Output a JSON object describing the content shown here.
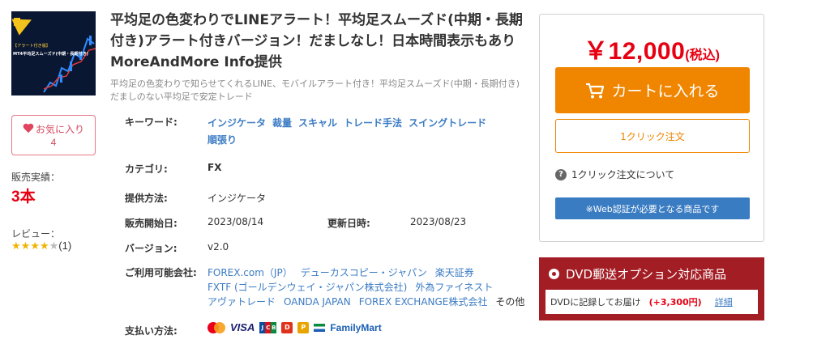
{
  "product": {
    "thumbnail": {
      "tag_line1": "【アラート付き版】",
      "tag_line2": "MT4平均足スムーズド(中期・長期付き)"
    },
    "title": "平均足の色変わりでLINEアラート！平均足スムーズド(中期・長期付き)アラート付きバージョン！だましなし！日本時間表示もあり MoreAndMore Info提供",
    "subtitle": "平均足の色変わりで知らせてくれるLINE、モバイルアラート付き！平均足スムーズド(中期・長期付き)　だましのない平均足で安定トレード"
  },
  "favorite": {
    "label": "お気に入り",
    "count": "4"
  },
  "sales": {
    "label": "販売実績：",
    "value": "3本"
  },
  "review": {
    "label": "レビュー：",
    "stars_filled": 4,
    "stars_total": 5,
    "count": "(1)"
  },
  "details": {
    "keyword_label": "キーワード:",
    "keywords": [
      "インジケータ",
      "裁量",
      "スキャル",
      "トレード手法",
      "スイングトレード",
      "順張り"
    ],
    "category_label": "カテゴリ:",
    "category": "FX",
    "provision_label": "提供方法:",
    "provision": "インジケータ",
    "start_label": "販売開始日:",
    "start_date": "2023/08/14",
    "updated_label": "更新日時:",
    "updated_date": "2023/08/23",
    "version_label": "バージョン:",
    "version": "v2.0",
    "companies_label": "ご利用可能会社:",
    "companies": [
      "FOREX.com（JP）",
      "デューカスコピー・ジャパン",
      "楽天証券",
      "FXTF (ゴールデンウェイ・ジャパン株式会社)",
      "外為ファイネスト",
      "アヴァトレード",
      "OANDA JAPAN",
      "FOREX EXCHANGE株式会社"
    ],
    "companies_other": "その他",
    "payment_label": "支払い方法:",
    "payment_visa": "VISA",
    "payment_familymart": "FamilyMart"
  },
  "purchase": {
    "price": "￥12,000",
    "tax": "(税込)",
    "cart_button": "カートに入れる",
    "one_click_button": "1クリック注文",
    "one_click_about": "1クリック注文について",
    "web_auth": "※Web認証が必要となる商品です"
  },
  "dvd": {
    "title": "DVD郵送オプション対応商品",
    "desc": "DVDに記録してお届け",
    "price": "(+3,300円)",
    "more": "詳細"
  },
  "colors": {
    "price_red": "#e60012",
    "cart_orange": "#f08500",
    "link_blue": "#3c7cc4",
    "dvd_red": "#a31d24",
    "star_gold": "#f0b400"
  }
}
